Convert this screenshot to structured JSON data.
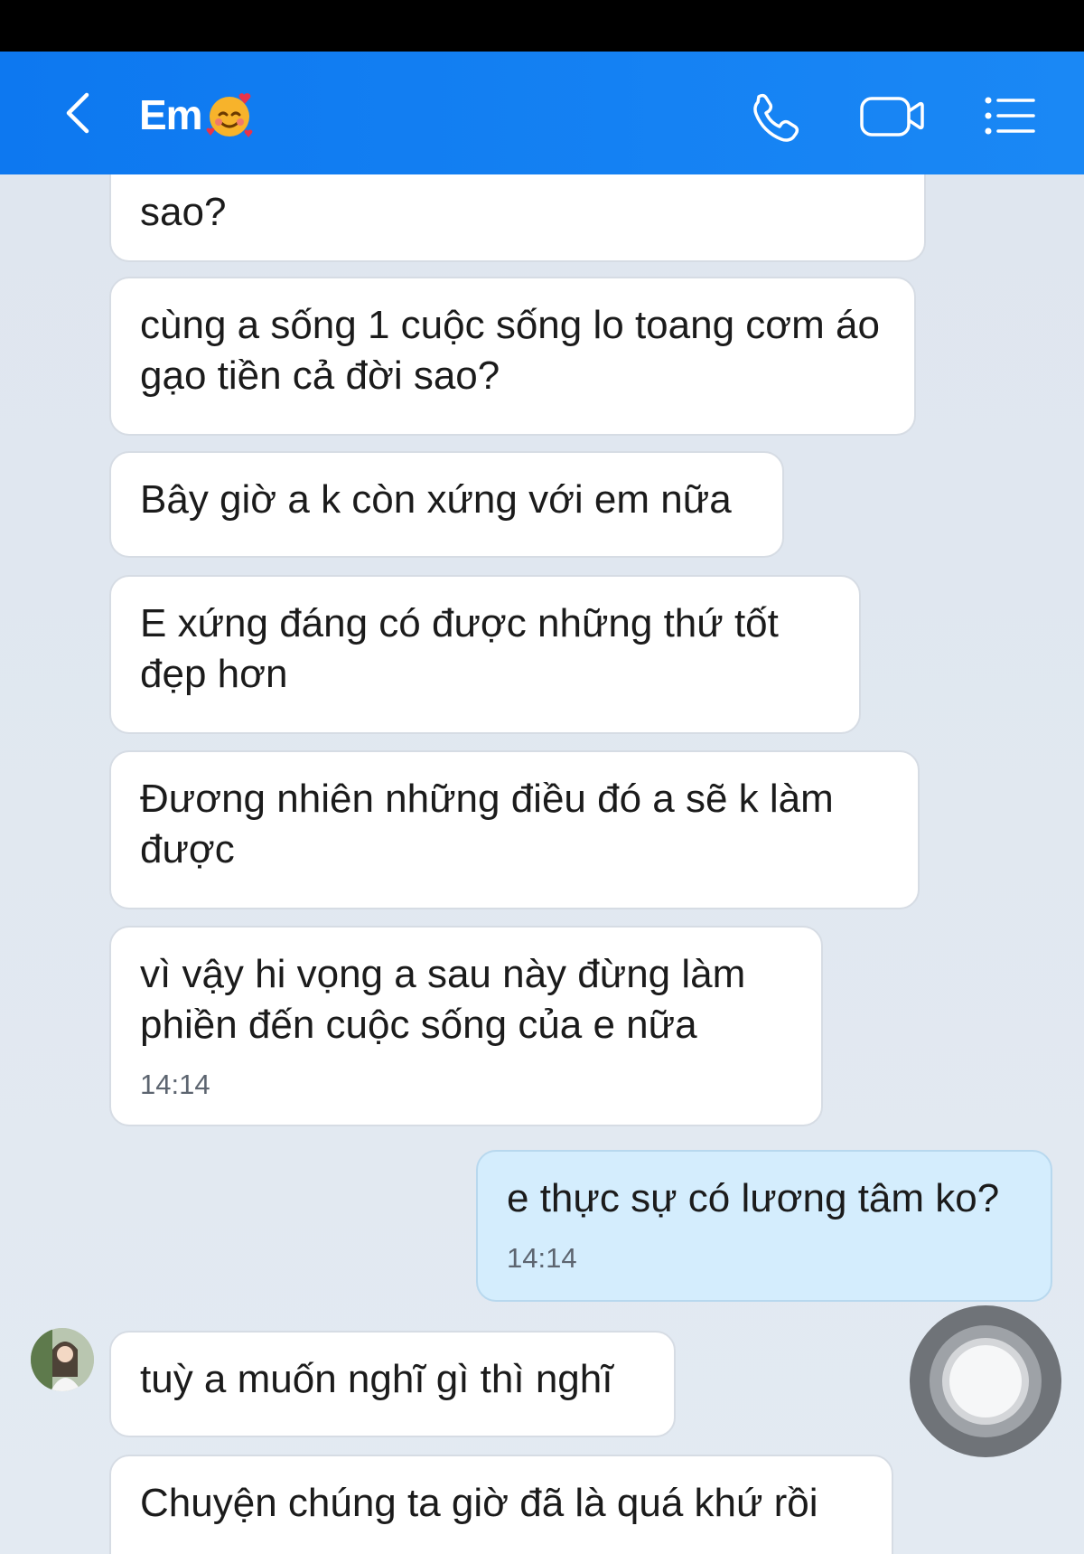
{
  "header": {
    "title": "Em",
    "emoji": "smiling-face-with-hearts",
    "accent": "#1282f2"
  },
  "messages": [
    {
      "side": "received",
      "text": "sao?",
      "time": ""
    },
    {
      "side": "received",
      "text": "cùng a sống 1 cuộc sống lo toang cơm áo gạo tiền cả đời sao?",
      "time": ""
    },
    {
      "side": "received",
      "text": "Bây giờ a k còn xứng với em nữa",
      "time": ""
    },
    {
      "side": "received",
      "text": "E xứng đáng có được những thứ tốt đẹp hơn",
      "time": ""
    },
    {
      "side": "received",
      "text": "Đương nhiên những điều đó a sẽ k làm được",
      "time": ""
    },
    {
      "side": "received",
      "text": "vì vậy hi vọng a sau này đừng làm phiền đến cuộc sống của e nữa",
      "time": "14:14"
    },
    {
      "side": "sent",
      "text": "e thực sự có lương tâm ko?",
      "time": "14:14"
    },
    {
      "side": "received",
      "text": "tuỳ a muốn nghĩ gì thì nghĩ",
      "time": ""
    },
    {
      "side": "received",
      "text": "Chuyện chúng ta giờ đã là quá khứ rồi",
      "time": ""
    }
  ]
}
